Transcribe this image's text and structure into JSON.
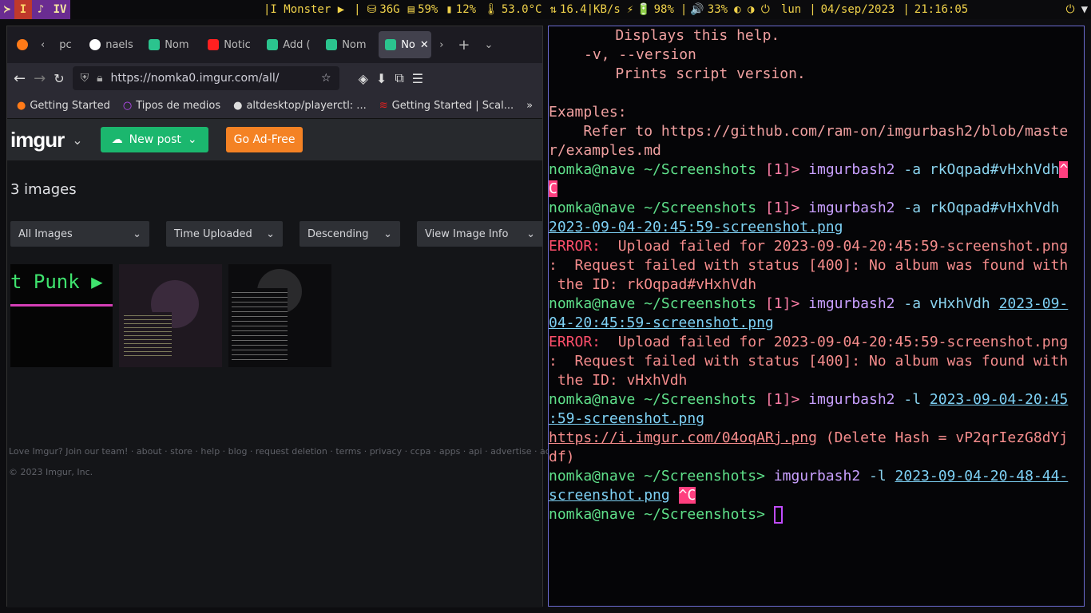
{
  "topbar": {
    "workspaces": [
      "I",
      "♪",
      "IV"
    ],
    "now_playing": "|I Monster ▶",
    "disk": "36G",
    "mem": "59%",
    "cpu": "12%",
    "temp": "53.0°C",
    "net": "16.4|KB/s",
    "battery": "98%",
    "volume": "33%",
    "day": "lun",
    "date": "04/sep/2023",
    "time": "21:16:05"
  },
  "browser": {
    "tabs": [
      {
        "label": "pc",
        "color": "#888"
      },
      {
        "label": "naels",
        "color": "#fff"
      },
      {
        "label": "Nom",
        "color": "#2bc48e"
      },
      {
        "label": "Notic",
        "color": "#ff2020"
      },
      {
        "label": "Add (",
        "color": "#2bc48e"
      },
      {
        "label": "Nom",
        "color": "#2bc48e"
      },
      {
        "label": "No",
        "color": "#2bc48e"
      }
    ],
    "url": "https://nomka0.imgur.com/all/",
    "bookmarks": [
      "Getting Started",
      "Tipos de medios",
      "altdesktop/playerctl: ...",
      "Getting Started | Scal..."
    ],
    "imgur": {
      "logo": "imgur",
      "new_post": "New post",
      "ad_free": "Go Ad-Free",
      "count": "3 images",
      "filters": [
        "All Images",
        "Time Uploaded",
        "Descending",
        "View Image Info"
      ],
      "thumb1_text": "t Punk ▶",
      "footer": "Love Imgur? Join our team! · about · store · help · blog · request deletion · terms · privacy · ccpa · apps · api · advertise · ad choices",
      "copyright": "© 2023 Imgur, Inc."
    }
  },
  "terminal": {
    "l1": "    Displays this help.",
    "l2": "-v, --version",
    "l3": "    Prints script version.",
    "l5": "Examples:",
    "l6": "    Refer to https://github.com/ram-on/imgurbash2/blob/maste",
    "l7": "r/examples.md",
    "prompt": "nomka@nave ~/Screenshots",
    "code1": "[1]>",
    "arrow": ">",
    "cmd": "imgurbash2",
    "cmd1": "-a rkOqpad#vHxhVdh",
    "ctrlc": "^",
    "ctrlc2": "C",
    "ctrlc_full": "^C",
    "file1": "2023-09-04-20:45:59-screenshot.png",
    "error": "ERROR:",
    "err1a": "  Upload failed for 2023-09-04-20:45:59-screenshot.png",
    "err1b": ":  Request failed with status [400]: No album was found with",
    "err1c": " the ID: rkOqpad#vHxhVdh",
    "cmd2": "-a vHxhVdh",
    "file2a": "2023-09-",
    "file2b": "04-20:45:59-screenshot.png",
    "err2c": " the ID: vHxhVdh",
    "cmd3": "-l",
    "file3a": "2023-09-04-20:45",
    "file3b": ":59-screenshot.png",
    "link": "https://i.imgur.com/04oqARj.png",
    "hash1": "(Delete Hash = vP2qrIezG8dYj",
    "hash2": "df)",
    "file4a": "2023-09-04-20-48-44-",
    "file4b": "screenshot.png"
  }
}
